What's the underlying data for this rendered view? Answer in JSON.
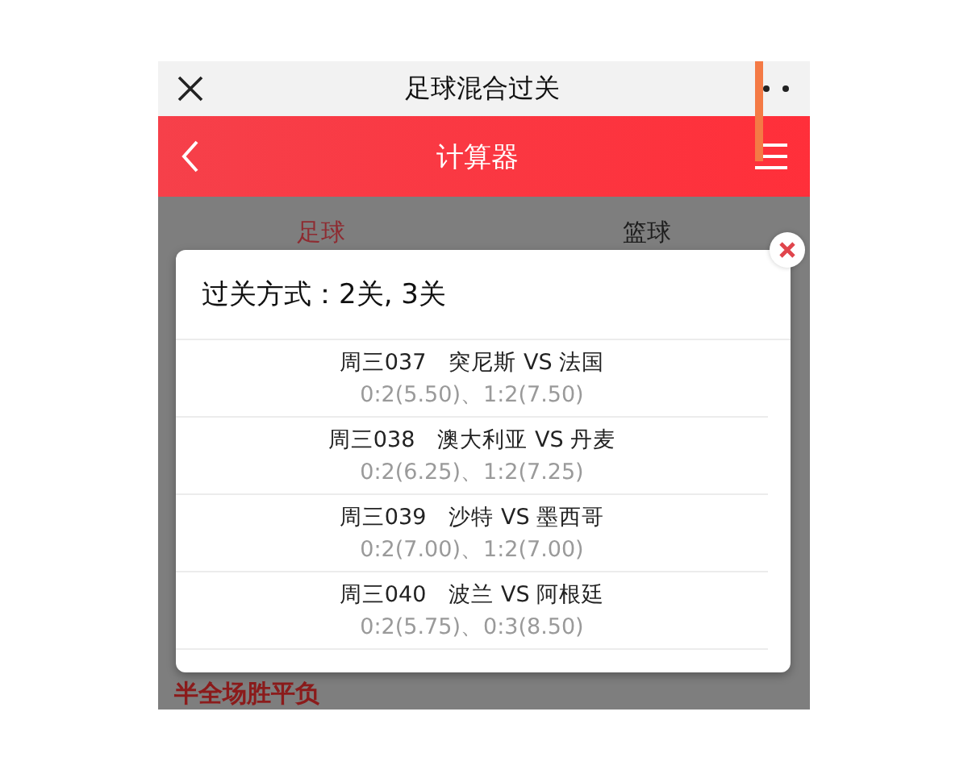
{
  "top_bar": {
    "title": "足球混合过关"
  },
  "header": {
    "title": "计算器"
  },
  "tabs": [
    {
      "label": "足球",
      "selected": true
    },
    {
      "label": "篮球",
      "selected": false
    }
  ],
  "section_label": "半全场胜平负",
  "dialog": {
    "title": "过关方式：2关, 3关",
    "matches": [
      {
        "code": "周三037",
        "teams": "突尼斯 VS 法国",
        "odds": "0:2(5.50)、1:2(7.50)"
      },
      {
        "code": "周三038",
        "teams": "澳大利亚 VS 丹麦",
        "odds": "0:2(6.25)、1:2(7.25)"
      },
      {
        "code": "周三039",
        "teams": "沙特 VS 墨西哥",
        "odds": "0:2(7.00)、1:2(7.00)"
      },
      {
        "code": "周三040",
        "teams": "波兰 VS 阿根廷",
        "odds": "0:2(5.75)、0:3(8.50)"
      }
    ]
  }
}
